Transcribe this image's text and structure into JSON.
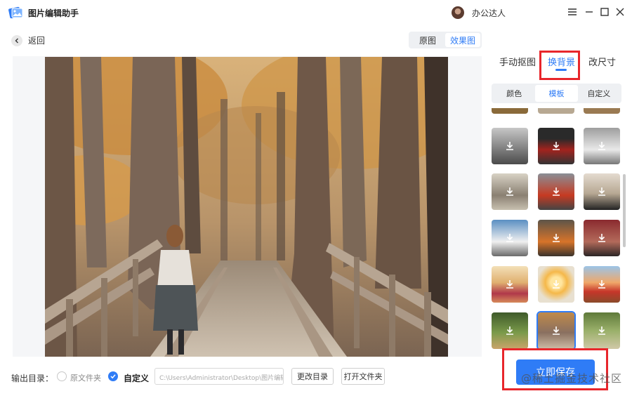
{
  "app": {
    "title": "图片编辑助手"
  },
  "user": {
    "name": "办公达人"
  },
  "nav": {
    "back_label": "返回"
  },
  "view_toggle": {
    "original": "原图",
    "result": "效果图",
    "active": "result"
  },
  "right_panel": {
    "tabs": [
      "手动抠图",
      "换背景",
      "改尺寸"
    ],
    "active_tab": "换背景",
    "subtabs": [
      "颜色",
      "模板",
      "自定义"
    ],
    "active_subtab": "模板"
  },
  "templates": [
    "mountain-road",
    "red-truck",
    "white-suv",
    "street-car",
    "red-car-city",
    "black-car-house",
    "classic-car",
    "orange-car-house",
    "motorcycle-room",
    "flower-field-tree",
    "sunset-abstract",
    "red-flower-field",
    "forest-path",
    "bridge-forest",
    "stone-steps-forest"
  ],
  "output": {
    "label": "输出目录：",
    "option_original": "原文件夹",
    "option_custom": "自定义",
    "selected": "custom",
    "path": "C:\\Users\\Administrator\\Desktop\\图片编辑",
    "change_button": "更改目录",
    "open_button": "打开文件夹"
  },
  "save_button": "立即保存",
  "watermark": "@稀土掘金技术社区",
  "colors": {
    "accent": "#2f7cf6",
    "highlight": "#e8262b"
  }
}
